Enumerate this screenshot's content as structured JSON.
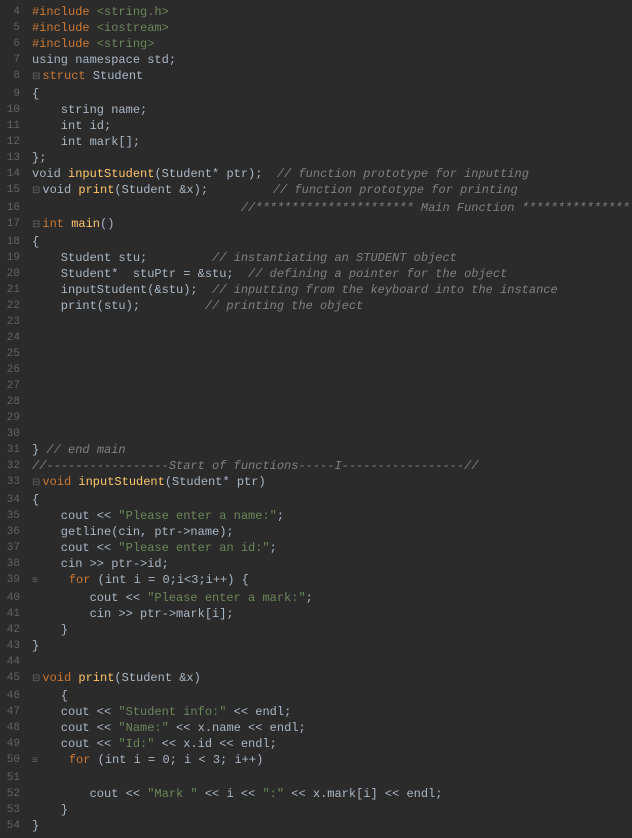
{
  "lines": [
    {
      "num": "4",
      "content": [
        {
          "t": "kw",
          "v": "#include "
        },
        {
          "t": "str",
          "v": "<string.h>"
        }
      ]
    },
    {
      "num": "5",
      "content": [
        {
          "t": "kw",
          "v": "#include "
        },
        {
          "t": "str",
          "v": "<iostream>"
        }
      ]
    },
    {
      "num": "6",
      "content": [
        {
          "t": "kw",
          "v": "#include "
        },
        {
          "t": "str",
          "v": "<string>"
        }
      ]
    },
    {
      "num": "7",
      "content": [
        {
          "t": "plain",
          "v": "using namespace std;"
        }
      ]
    },
    {
      "num": "8",
      "content": [
        {
          "t": "fold",
          "v": "⊟"
        },
        {
          "t": "kw",
          "v": "struct "
        },
        {
          "t": "plain",
          "v": "Student"
        }
      ]
    },
    {
      "num": "9",
      "content": [
        {
          "t": "plain",
          "v": "{"
        }
      ]
    },
    {
      "num": "10",
      "content": [
        {
          "t": "plain",
          "v": "    string name;"
        }
      ]
    },
    {
      "num": "11",
      "content": [
        {
          "t": "plain",
          "v": "    int id;"
        }
      ]
    },
    {
      "num": "12",
      "content": [
        {
          "t": "plain",
          "v": "    int mark[];"
        }
      ]
    },
    {
      "num": "13",
      "content": [
        {
          "t": "plain",
          "v": "};"
        }
      ]
    },
    {
      "num": "14",
      "content": [
        {
          "t": "plain",
          "v": "void "
        },
        {
          "t": "fn",
          "v": "inputStudent"
        },
        {
          "t": "plain",
          "v": "(Student* ptr);  "
        },
        {
          "t": "comment",
          "v": "// function prototype for inputting"
        }
      ]
    },
    {
      "num": "15",
      "content": [
        {
          "t": "fold",
          "v": "⊟"
        },
        {
          "t": "plain",
          "v": "void "
        },
        {
          "t": "fn",
          "v": "print"
        },
        {
          "t": "plain",
          "v": "(Student &x);         "
        },
        {
          "t": "comment",
          "v": "// function prototype for printing"
        }
      ]
    },
    {
      "num": "16",
      "content": [
        {
          "t": "plain",
          "v": "                             "
        },
        {
          "t": "comment",
          "v": "//********************** Main Function ************************//"
        }
      ]
    },
    {
      "num": "17",
      "content": [
        {
          "t": "fold",
          "v": "⊟"
        },
        {
          "t": "kw",
          "v": "int "
        },
        {
          "t": "fn",
          "v": "main"
        },
        {
          "t": "plain",
          "v": "()"
        }
      ]
    },
    {
      "num": "18",
      "content": [
        {
          "t": "plain",
          "v": "{"
        }
      ]
    },
    {
      "num": "19",
      "content": [
        {
          "t": "plain",
          "v": "    Student stu;         "
        },
        {
          "t": "comment",
          "v": "// instantiating an STUDENT object"
        }
      ]
    },
    {
      "num": "20",
      "content": [
        {
          "t": "plain",
          "v": "    Student*  stuPtr = &stu;  "
        },
        {
          "t": "comment",
          "v": "// defining a pointer for the object"
        }
      ]
    },
    {
      "num": "21",
      "content": [
        {
          "t": "plain",
          "v": "    inputStudent(&stu);  "
        },
        {
          "t": "comment",
          "v": "// inputting from the keyboard into the instance"
        }
      ]
    },
    {
      "num": "22",
      "content": [
        {
          "t": "plain",
          "v": "    print(stu);         "
        },
        {
          "t": "comment",
          "v": "// printing the object"
        }
      ]
    },
    {
      "num": "23",
      "content": []
    },
    {
      "num": "24",
      "content": []
    },
    {
      "num": "25",
      "content": []
    },
    {
      "num": "26",
      "content": []
    },
    {
      "num": "27",
      "content": []
    },
    {
      "num": "28",
      "content": []
    },
    {
      "num": "29",
      "content": []
    },
    {
      "num": "30",
      "content": []
    },
    {
      "num": "31",
      "content": [
        {
          "t": "plain",
          "v": "} "
        },
        {
          "t": "comment",
          "v": "// end main"
        }
      ]
    },
    {
      "num": "32",
      "content": [
        {
          "t": "comment",
          "v": "//-----------------Start of functions-----I-----------------//"
        }
      ]
    },
    {
      "num": "33",
      "content": [
        {
          "t": "fold",
          "v": "⊟"
        },
        {
          "t": "kw",
          "v": "void "
        },
        {
          "t": "fn",
          "v": "inputStudent"
        },
        {
          "t": "plain",
          "v": "(Student* ptr)"
        }
      ]
    },
    {
      "num": "34",
      "content": [
        {
          "t": "plain",
          "v": "{"
        }
      ]
    },
    {
      "num": "35",
      "content": [
        {
          "t": "plain",
          "v": "    cout << "
        },
        {
          "t": "str",
          "v": "\"Please enter a name:\""
        },
        {
          "t": "plain",
          "v": ";"
        }
      ]
    },
    {
      "num": "36",
      "content": [
        {
          "t": "plain",
          "v": "    getline(cin, ptr->name);"
        }
      ]
    },
    {
      "num": "37",
      "content": [
        {
          "t": "plain",
          "v": "    cout << "
        },
        {
          "t": "str",
          "v": "\"Please enter an id:\""
        },
        {
          "t": "plain",
          "v": ";"
        }
      ]
    },
    {
      "num": "38",
      "content": [
        {
          "t": "plain",
          "v": "    cin >> ptr->id;"
        }
      ]
    },
    {
      "num": "39",
      "content": [
        {
          "t": "fold",
          "v": "≡"
        },
        {
          "t": "plain",
          "v": "    "
        },
        {
          "t": "kw",
          "v": "for"
        },
        {
          "t": "plain",
          "v": " (int i = 0;i<3;i++) {"
        }
      ]
    },
    {
      "num": "40",
      "content": [
        {
          "t": "plain",
          "v": "        cout << "
        },
        {
          "t": "str",
          "v": "\"Please enter a mark:\""
        },
        {
          "t": "plain",
          "v": ";"
        }
      ]
    },
    {
      "num": "41",
      "content": [
        {
          "t": "plain",
          "v": "        cin >> ptr->mark[i];"
        }
      ]
    },
    {
      "num": "42",
      "content": [
        {
          "t": "plain",
          "v": "    }"
        }
      ]
    },
    {
      "num": "43",
      "content": [
        {
          "t": "plain",
          "v": "}"
        }
      ]
    },
    {
      "num": "44",
      "content": []
    },
    {
      "num": "45",
      "content": [
        {
          "t": "fold",
          "v": "⊟"
        },
        {
          "t": "kw",
          "v": "void "
        },
        {
          "t": "fn",
          "v": "print"
        },
        {
          "t": "plain",
          "v": "(Student &x)"
        }
      ]
    },
    {
      "num": "46",
      "content": [
        {
          "t": "plain",
          "v": "    {"
        }
      ]
    },
    {
      "num": "47",
      "content": [
        {
          "t": "plain",
          "v": "    cout << "
        },
        {
          "t": "str",
          "v": "\"Student info:\""
        },
        {
          "t": "plain",
          "v": " << endl;"
        }
      ]
    },
    {
      "num": "48",
      "content": [
        {
          "t": "plain",
          "v": "    cout << "
        },
        {
          "t": "str",
          "v": "\"Name:\""
        },
        {
          "t": "plain",
          "v": " << x.name << endl;"
        }
      ]
    },
    {
      "num": "49",
      "content": [
        {
          "t": "plain",
          "v": "    cout << "
        },
        {
          "t": "str",
          "v": "\"Id:\""
        },
        {
          "t": "plain",
          "v": " << x.id << endl;"
        }
      ]
    },
    {
      "num": "50",
      "content": [
        {
          "t": "fold",
          "v": "≡"
        },
        {
          "t": "plain",
          "v": "    "
        },
        {
          "t": "kw",
          "v": "for"
        },
        {
          "t": "plain",
          "v": " (int i = 0; i < 3; i++)"
        }
      ]
    },
    {
      "num": "51",
      "content": []
    },
    {
      "num": "52",
      "content": [
        {
          "t": "plain",
          "v": "        cout << "
        },
        {
          "t": "str",
          "v": "\"Mark \""
        },
        {
          "t": "plain",
          "v": " << i << "
        },
        {
          "t": "str",
          "v": "\":\""
        },
        {
          "t": "plain",
          "v": " << x.mark[i] << endl;"
        }
      ]
    },
    {
      "num": "53",
      "content": [
        {
          "t": "plain",
          "v": "    }"
        }
      ]
    },
    {
      "num": "54",
      "content": [
        {
          "t": "plain",
          "v": "}"
        }
      ]
    }
  ]
}
